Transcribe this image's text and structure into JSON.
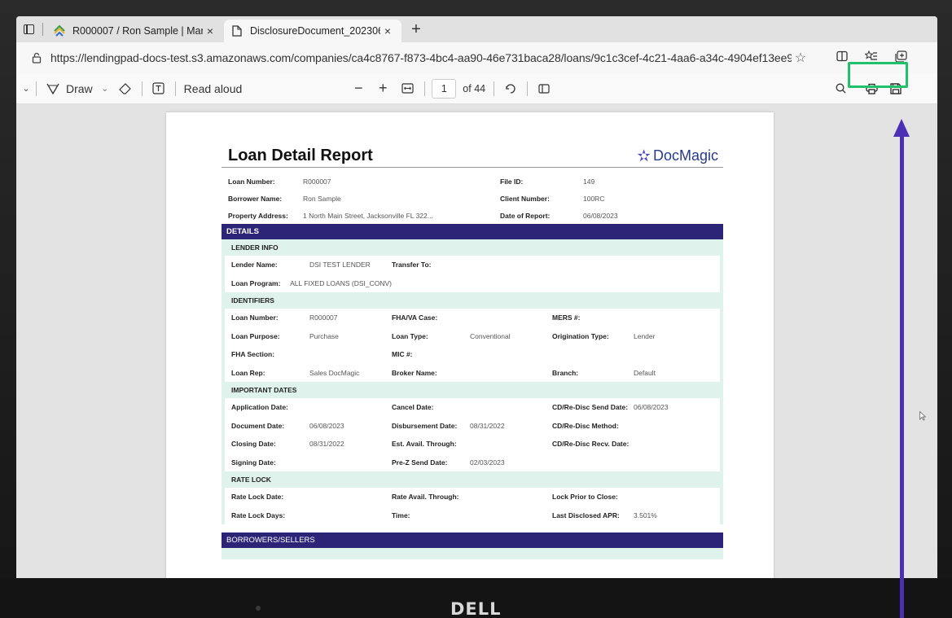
{
  "tabs": [
    {
      "title": "R000007 / Ron Sample | Manage",
      "close": "×",
      "favicon": "stack-icon"
    },
    {
      "title": "DisclosureDocument_20230608-",
      "close": "×",
      "favicon": "document-icon"
    }
  ],
  "newtab": "+",
  "address": {
    "url": "https://lendingpad-docs-test.s3.amazonaws.com/companies/ca4c8767-f873-4bc4-aa90-46e731baca28/loans/9c1c3cef-4c21-4aa6-a34c-4904ef13ee98/docum..."
  },
  "pdf_toolbar": {
    "draw": "Draw",
    "read_aloud": "Read aloud",
    "zoom_out": "−",
    "zoom_in": "+",
    "page": "1",
    "of_pages": "of 44"
  },
  "report": {
    "title": "Loan Detail Report",
    "logo": "DocMagic",
    "header_rows": [
      {
        "k1": "Loan Number:",
        "v1": "R000007",
        "k2": "File ID:",
        "v2": "149"
      },
      {
        "k1": "Borrower Name:",
        "v1": "Ron Sample",
        "k2": "Client Number:",
        "v2": "100RC"
      },
      {
        "k1": "Property Address:",
        "v1": "1 North Main Street, Jacksonville FL 322...",
        "k2": "Date of Report:",
        "v2": "06/08/2023"
      }
    ],
    "details_label": "DETAILS",
    "lender_info": {
      "label": "LENDER INFO",
      "rows": [
        [
          "Lender Name:",
          "DSI TEST LENDER",
          "Transfer To:",
          "",
          "",
          ""
        ],
        [
          "Loan Program:",
          "ALL FIXED LOANS (DSI_CONV)",
          "",
          "",
          "",
          ""
        ]
      ]
    },
    "identifiers": {
      "label": "IDENTIFIERS",
      "rows": [
        [
          "Loan Number:",
          "R000007",
          "FHA/VA Case:",
          "",
          "MERS #:",
          ""
        ],
        [
          "Loan Purpose:",
          "Purchase",
          "Loan Type:",
          "Conventional",
          "Origination Type:",
          "Lender"
        ],
        [
          "FHA Section:",
          "",
          "MIC #:",
          "",
          "",
          ""
        ],
        [
          "Loan Rep:",
          "Sales DocMagic",
          "Broker Name:",
          "",
          "Branch:",
          "Default"
        ]
      ]
    },
    "important_dates": {
      "label": "IMPORTANT DATES",
      "rows": [
        [
          "Application Date:",
          "",
          "Cancel Date:",
          "",
          "CD/Re-Disc Send Date:",
          "06/08/2023"
        ],
        [
          "Document Date:",
          "06/08/2023",
          "Disbursement Date:",
          "08/31/2022",
          "CD/Re-Disc Method:",
          ""
        ],
        [
          "Closing Date:",
          "08/31/2022",
          "Est. Avail. Through:",
          "",
          "CD/Re-Disc Recv. Date:",
          ""
        ],
        [
          "Signing Date:",
          "",
          "Pre-Z Send Date:",
          "02/03/2023",
          "",
          ""
        ]
      ]
    },
    "rate_lock": {
      "label": "RATE LOCK",
      "rows": [
        [
          "Rate Lock Date:",
          "",
          "Rate Avail. Through:",
          "",
          "Lock Prior to Close:",
          ""
        ],
        [
          "Rate Lock Days:",
          "",
          "Time:",
          "",
          "Last Disclosed APR:",
          "3.501%"
        ]
      ]
    },
    "borrowers_label": "BORROWERS/SELLERS"
  },
  "bezel": {
    "brand": "DELL"
  },
  "colors": {
    "highlight": "#1fc26a",
    "arrow": "#4b2fb4",
    "section_bar": "#2c2577",
    "section_sub": "#dff2ec"
  }
}
